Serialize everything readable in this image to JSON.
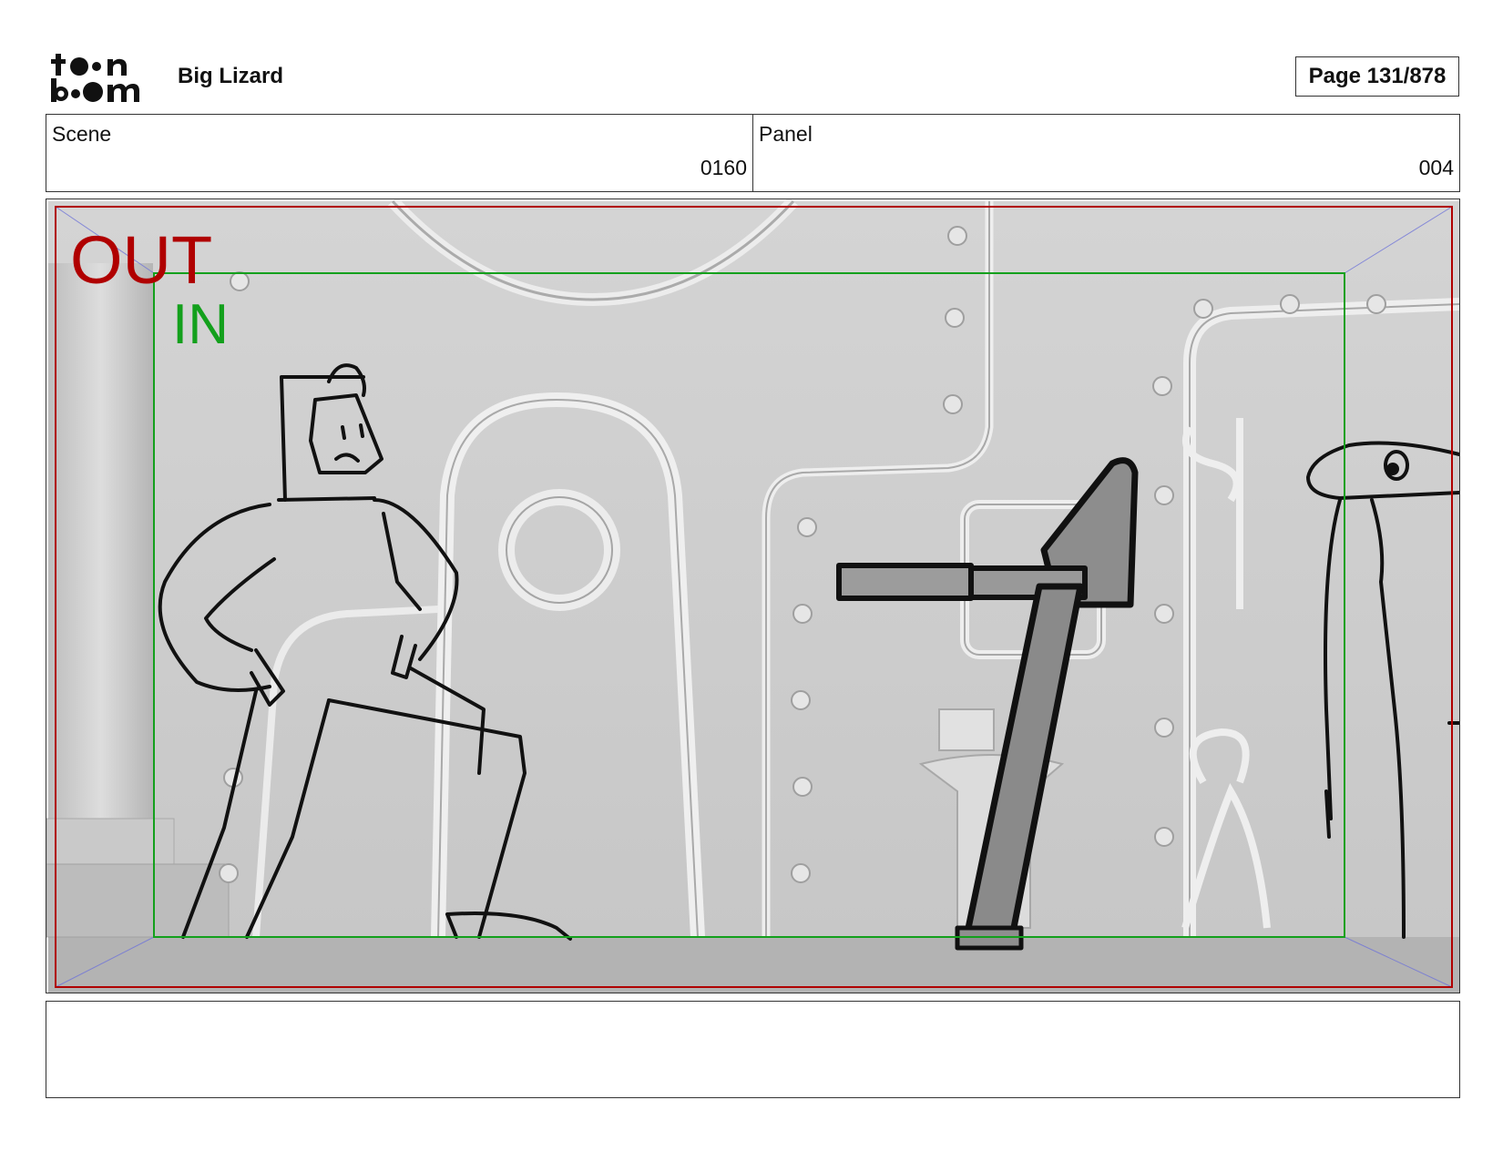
{
  "header": {
    "logo": {
      "line1": "toon",
      "line2": "boom"
    },
    "project_title": "Big Lizard",
    "page_indicator": "Page 131/878"
  },
  "meta": {
    "scene_label": "Scene",
    "scene_value": "0160",
    "panel_label": "Panel",
    "panel_value": "004"
  },
  "panel": {
    "frame_labels": {
      "out": "OUT",
      "in": "IN"
    },
    "colors": {
      "out_frame": "#b00000",
      "in_frame": "#13a01c",
      "guides": "#6f74d8"
    }
  },
  "notes": {
    "text": ""
  }
}
